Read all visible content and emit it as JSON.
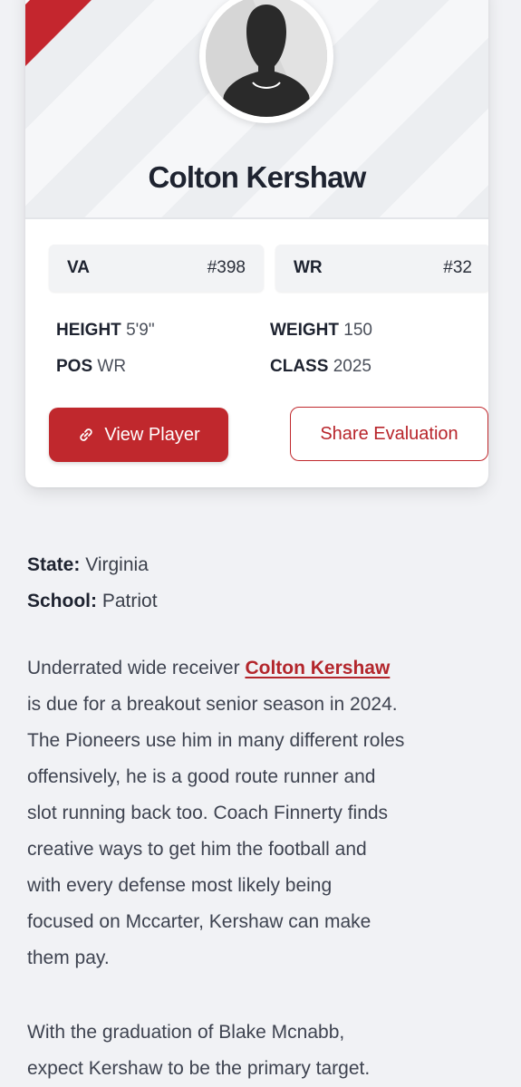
{
  "player": {
    "name": "Colton Kershaw",
    "state_abbr": "VA",
    "state_rank": "#398",
    "position_abbr": "WR",
    "position_rank": "#32"
  },
  "stats": {
    "height_label": "HEIGHT",
    "height_value": "5'9\"",
    "weight_label": "WEIGHT",
    "weight_value": "150",
    "pos_label": "POS",
    "pos_value": "WR",
    "class_label": "CLASS",
    "class_value": "2025"
  },
  "actions": {
    "view_label": "View Player",
    "share_label": "Share Evaluation"
  },
  "details": {
    "state_label": "State:",
    "state_value": "Virginia",
    "school_label": "School:",
    "school_value": "Patriot"
  },
  "article": {
    "p1_prefix": "Underrated wide receiver ",
    "p1_link": "Colton Kershaw",
    "p1_lines": [
      "is due for a breakout senior season in 2024.",
      "The Pioneers use him in many different roles",
      "offensively, he is a good route runner and",
      "slot running back too. Coach Finnerty finds",
      "creative ways to get him the football and",
      "with every defense most likely being",
      "focused on Mccarter, Kershaw can make",
      "them pay."
    ],
    "p2_lines": [
      "With the graduation of Blake Mcnabb,",
      "expect Kershaw to be the primary target."
    ]
  },
  "colors": {
    "accent": "#c0282d",
    "background": "#f1f2f5"
  }
}
